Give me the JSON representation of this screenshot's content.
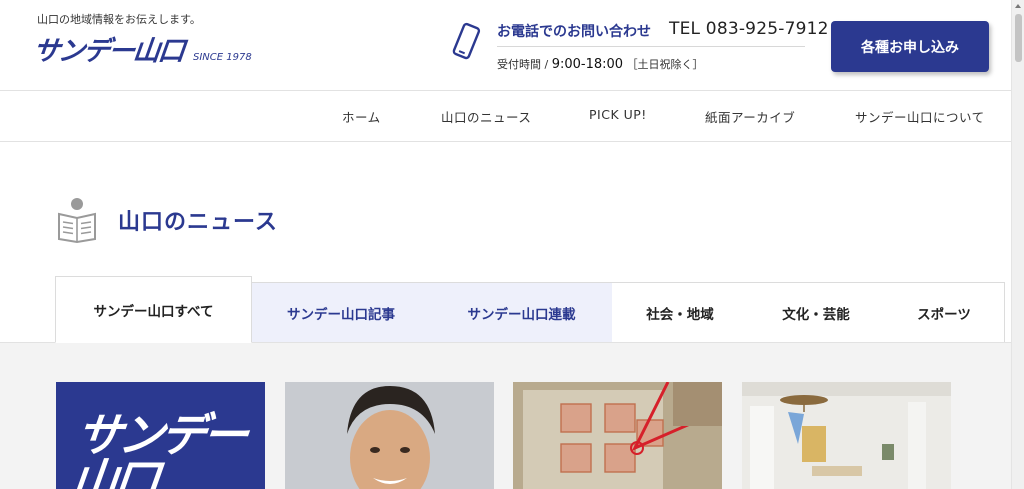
{
  "header": {
    "tagline": "山口の地域情報をお伝えします。",
    "logo_text": "サンデー山口",
    "logo_since": "SINCE 1978",
    "contact_label": "お電話でのお問い合わせ",
    "tel": "TEL 083-925-7912",
    "hours_prefix": "受付時間 / ",
    "hours_time": "9:00-18:00",
    "hours_note": "［土日祝除く］",
    "apply_label": "各種お申し込み"
  },
  "nav": {
    "items": [
      "ホーム",
      "山口のニュース",
      "PICK UP!",
      "紙面アーカイブ",
      "サンデー山口について"
    ]
  },
  "section": {
    "title": "山口のニュース"
  },
  "tabs": [
    {
      "label": "サンデー山口すべて"
    },
    {
      "label": "サンデー山口記事"
    },
    {
      "label": "サンデー山口連載"
    },
    {
      "label": "社会・地域"
    },
    {
      "label": "文化・芸能"
    },
    {
      "label": "スポーツ"
    }
  ],
  "cards": {
    "first_logo": "サンデー山口"
  },
  "colors": {
    "brand": "#2b3990",
    "tab_highlight": "#eef0fb",
    "content_bg": "#f3f3f3"
  },
  "icons": [
    "smartphone-icon",
    "newspaper-reader-icon"
  ]
}
